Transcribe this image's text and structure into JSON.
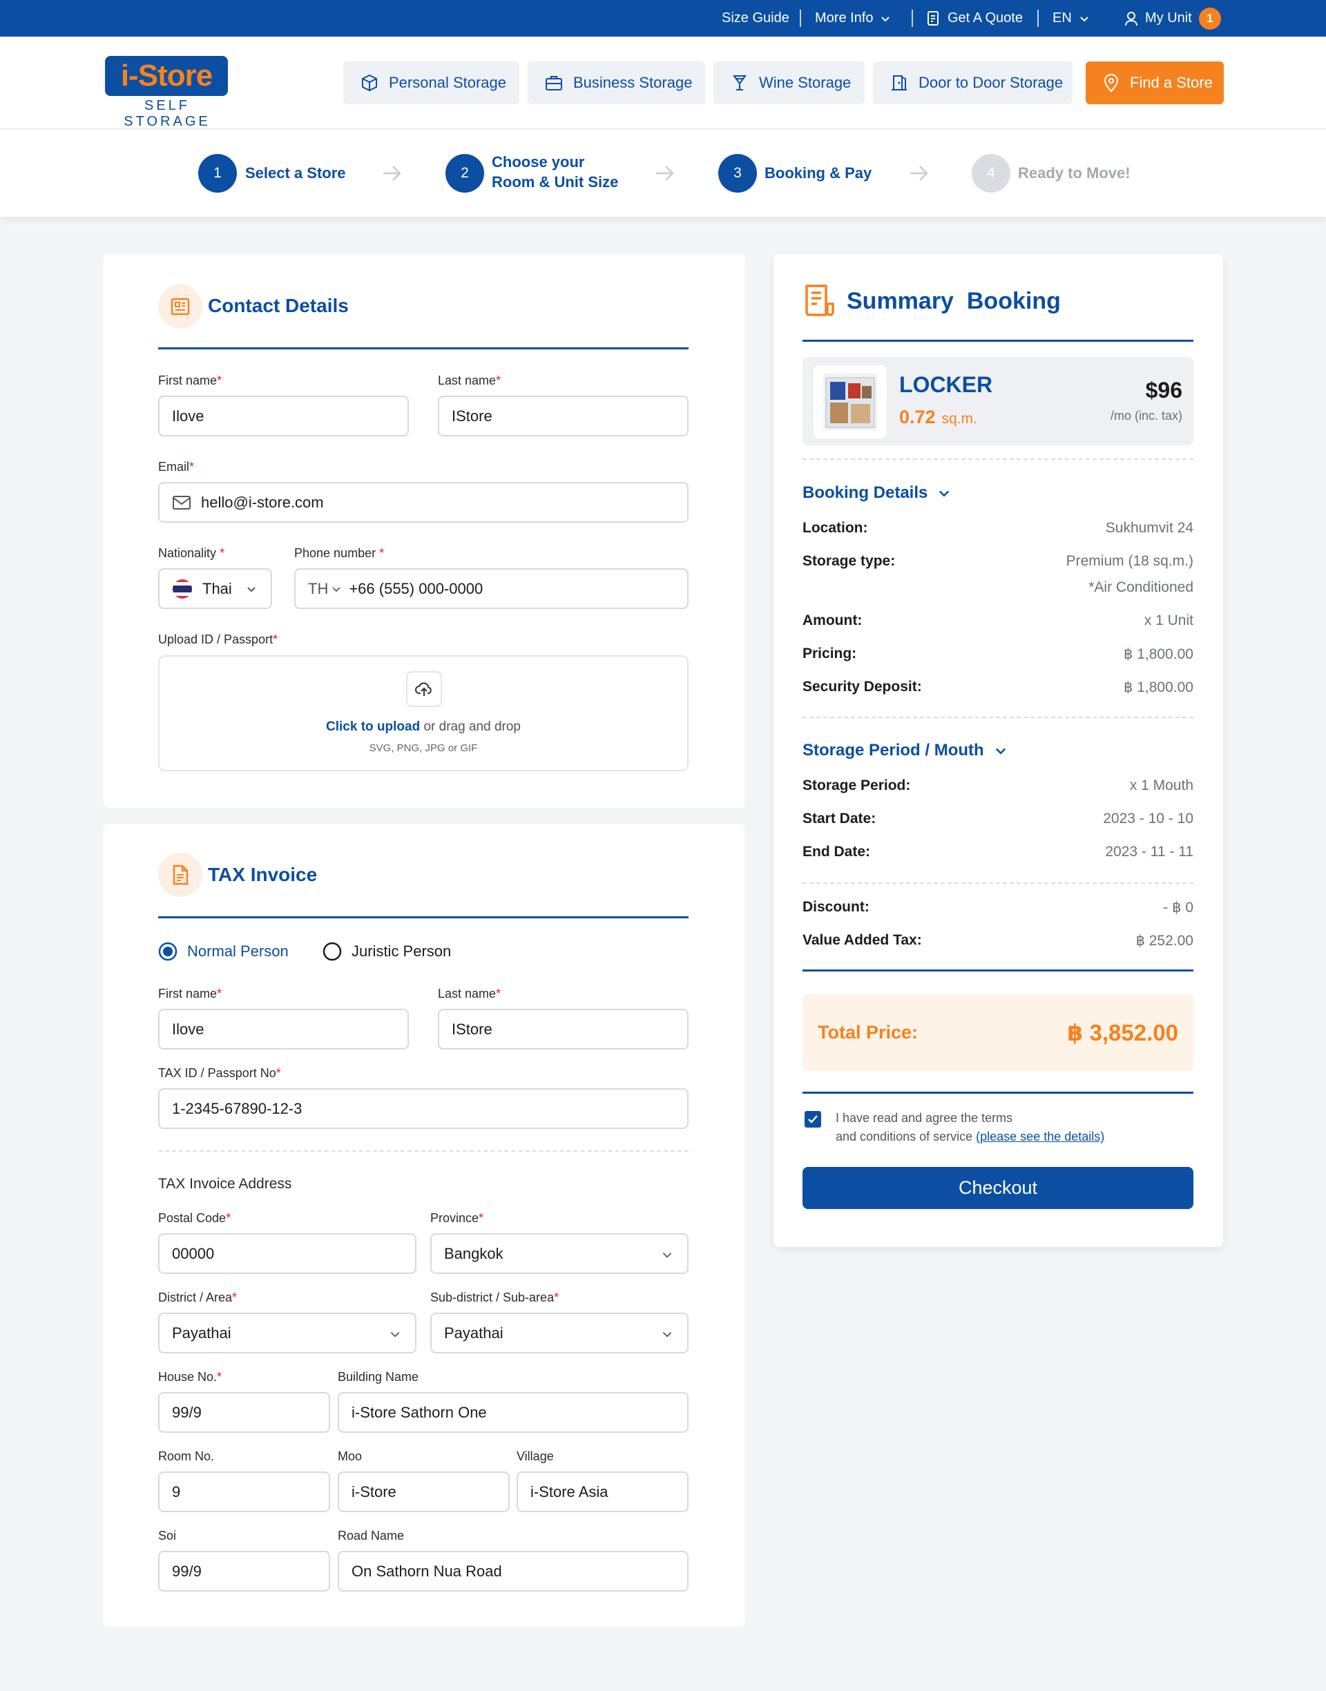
{
  "topbar": {
    "size_guide": "Size Guide",
    "more_info": "More Info",
    "get_quote": "Get A Quote",
    "language": "EN",
    "my_unit": "My Unit",
    "unit_count": "1"
  },
  "logo": {
    "main": "i-Store",
    "sub": "SELF STORAGE"
  },
  "nav": {
    "personal": "Personal Storage",
    "business": "Business Storage",
    "wine": "Wine Storage",
    "door": "Door to Door Storage",
    "find": "Find a Store"
  },
  "stepper": {
    "s1": {
      "num": "1",
      "label": "Select a Store"
    },
    "s2": {
      "num": "2",
      "label1": "Choose your",
      "label2": "Room & Unit Size"
    },
    "s3": {
      "num": "3",
      "label": "Booking & Pay"
    },
    "s4": {
      "num": "4",
      "label": "Ready to Move!"
    }
  },
  "contact": {
    "title": "Contact Details",
    "first_label": "First name",
    "first_value": "Ilove",
    "last_label": "Last name",
    "last_value": "IStore",
    "email_label": "Email",
    "email_value": "hello@i-store.com",
    "nationality_label": "Nationality",
    "nationality_value": "Thai",
    "phone_label": "Phone number",
    "phone_country": "TH",
    "phone_value": "+66 (555) 000-0000",
    "upload_label": "Upload ID / Passport",
    "upload_link": "Click to upload",
    "upload_text": "or drag and drop",
    "upload_formats": "SVG, PNG, JPG or GIF"
  },
  "tax": {
    "title": "TAX Invoice",
    "option_normal": "Normal Person",
    "option_juristic": "Juristic Person",
    "selected": "Normal Person",
    "first_label": "First name",
    "first_value": "Ilove",
    "last_label": "Last name",
    "last_value": "IStore",
    "taxid_label": "TAX ID / Passport No",
    "taxid_value": "1-2345-67890-12-3",
    "address_title": "TAX Invoice Address",
    "postal_label": "Postal Code",
    "postal_value": "00000",
    "province_label": "Province",
    "province_value": "Bangkok",
    "district_label": "District / Area",
    "district_value": "Payathai",
    "subdistrict_label": "Sub-district / Sub-area",
    "subdistrict_value": "Payathai",
    "house_label": "House No.",
    "house_value": "99/9",
    "building_label": "Building Name",
    "building_value": "i-Store Sathorn One",
    "room_label": "Room No.",
    "room_value": "9",
    "moo_label": "Moo",
    "moo_value": "i-Store",
    "village_label": "Village",
    "village_value": "i-Store Asia",
    "soi_label": "Soi",
    "soi_value": "99/9",
    "road_label": "Road Name",
    "road_value": "On Sathorn Nua Road"
  },
  "summary": {
    "title1": "Summary",
    "title2": "Booking",
    "unit_name": "LOCKER",
    "unit_size": "0.72",
    "unit_size_unit": "sq.m.",
    "price": "$96",
    "price_note": "/mo (inc. tax)",
    "booking_details": "Booking Details",
    "location_k": "Location:",
    "location_v": "Sukhumvit 24",
    "type_k": "Storage type:",
    "type_v": "Premium (18 sq.m.)",
    "type_v2": "*Air Conditioned",
    "amount_k": "Amount:",
    "amount_v": "x 1 Unit",
    "pricing_k": "Pricing:",
    "pricing_v": "฿ 1,800.00",
    "deposit_k": "Security Deposit:",
    "deposit_v": "฿ 1,800.00",
    "period_title": "Storage Period / Mouth",
    "period_k": "Storage Period:",
    "period_v": "x 1 Mouth",
    "start_k": "Start Date:",
    "start_v": "2023 - 10 - 10",
    "end_k": "End Date:",
    "end_v": "2023 - 11 - 11",
    "discount_k": "Discount:",
    "discount_v": "- ฿ 0",
    "vat_k": "Value Added Tax:",
    "vat_v": "฿ 252.00",
    "total_k": "Total Price:",
    "total_v": "฿ 3,852.00",
    "terms1": "I have read and agree the terms",
    "terms2": "and conditions of service",
    "terms_link": "(please see the details)",
    "terms_checked": true,
    "checkout": "Checkout"
  },
  "colors": {
    "brand": "#0b4ea2",
    "accent": "#f5821f",
    "required": "#e02424"
  }
}
